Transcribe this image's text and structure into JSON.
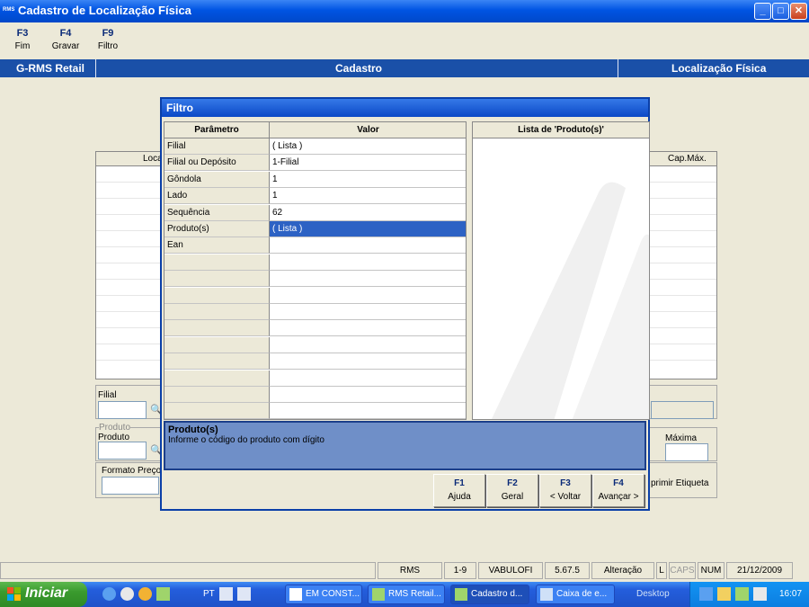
{
  "window": {
    "app_icon_text": "RMS",
    "title": "Cadastro de Localização Física"
  },
  "toolbar": [
    {
      "key": "F3",
      "label": "Fim"
    },
    {
      "key": "F4",
      "label": "Gravar"
    },
    {
      "key": "F9",
      "label": "Filtro"
    }
  ],
  "band": {
    "left": "G-RMS Retail",
    "center": "Cadastro",
    "right": "Localização Física"
  },
  "background_form": {
    "grid_col_left": "Loca",
    "grid_col_right": "Cap.Máx.",
    "filial_label": "Filial",
    "produto_group": "Produto",
    "produto_label": "Produto",
    "maxima_label": "Máxima",
    "formato_label": "Formato Preço I",
    "imprimir_label": "primir Etiqueta"
  },
  "dialog": {
    "title": "Filtro",
    "col_param": "Parâmetro",
    "col_value": "Valor",
    "rows": [
      {
        "param": "Filial",
        "value": "( Lista )"
      },
      {
        "param": "Filial ou Depósito",
        "value": "1-Filial"
      },
      {
        "param": "Gôndola",
        "value": "1"
      },
      {
        "param": "Lado",
        "value": "1"
      },
      {
        "param": "Sequência",
        "value": "62"
      },
      {
        "param": "Produto(s)",
        "value": "( Lista )"
      },
      {
        "param": "Ean",
        "value": ""
      }
    ],
    "selected_row": 5,
    "list_title": "Lista de 'Produto(s)'",
    "help_title": "Produto(s)",
    "help_text": "Informe o código do produto com dígito",
    "buttons": [
      {
        "key": "F1",
        "label": "Ajuda"
      },
      {
        "key": "F2",
        "label": "Geral"
      },
      {
        "key": "F3",
        "label": "< Voltar"
      },
      {
        "key": "F4",
        "label": "Avançar >"
      }
    ]
  },
  "statusbar": {
    "app": "RMS",
    "range": "1-9",
    "user": "VABULOFI",
    "version": "5.67.5",
    "mode": "Alteração",
    "l": "L",
    "caps": "CAPS",
    "num": "NUM",
    "date": "21/12/2009"
  },
  "taskbar": {
    "start": "Iniciar",
    "lang": "PT",
    "tasks": [
      "EM CONST...",
      "RMS Retail...",
      "Cadastro d...",
      "Caixa de e..."
    ],
    "desktop": "Desktop",
    "clock": "16:07"
  },
  "colors": {
    "accent": "#1a50a8",
    "selection": "#2d62c4",
    "help_bg": "#6f8fc8"
  }
}
